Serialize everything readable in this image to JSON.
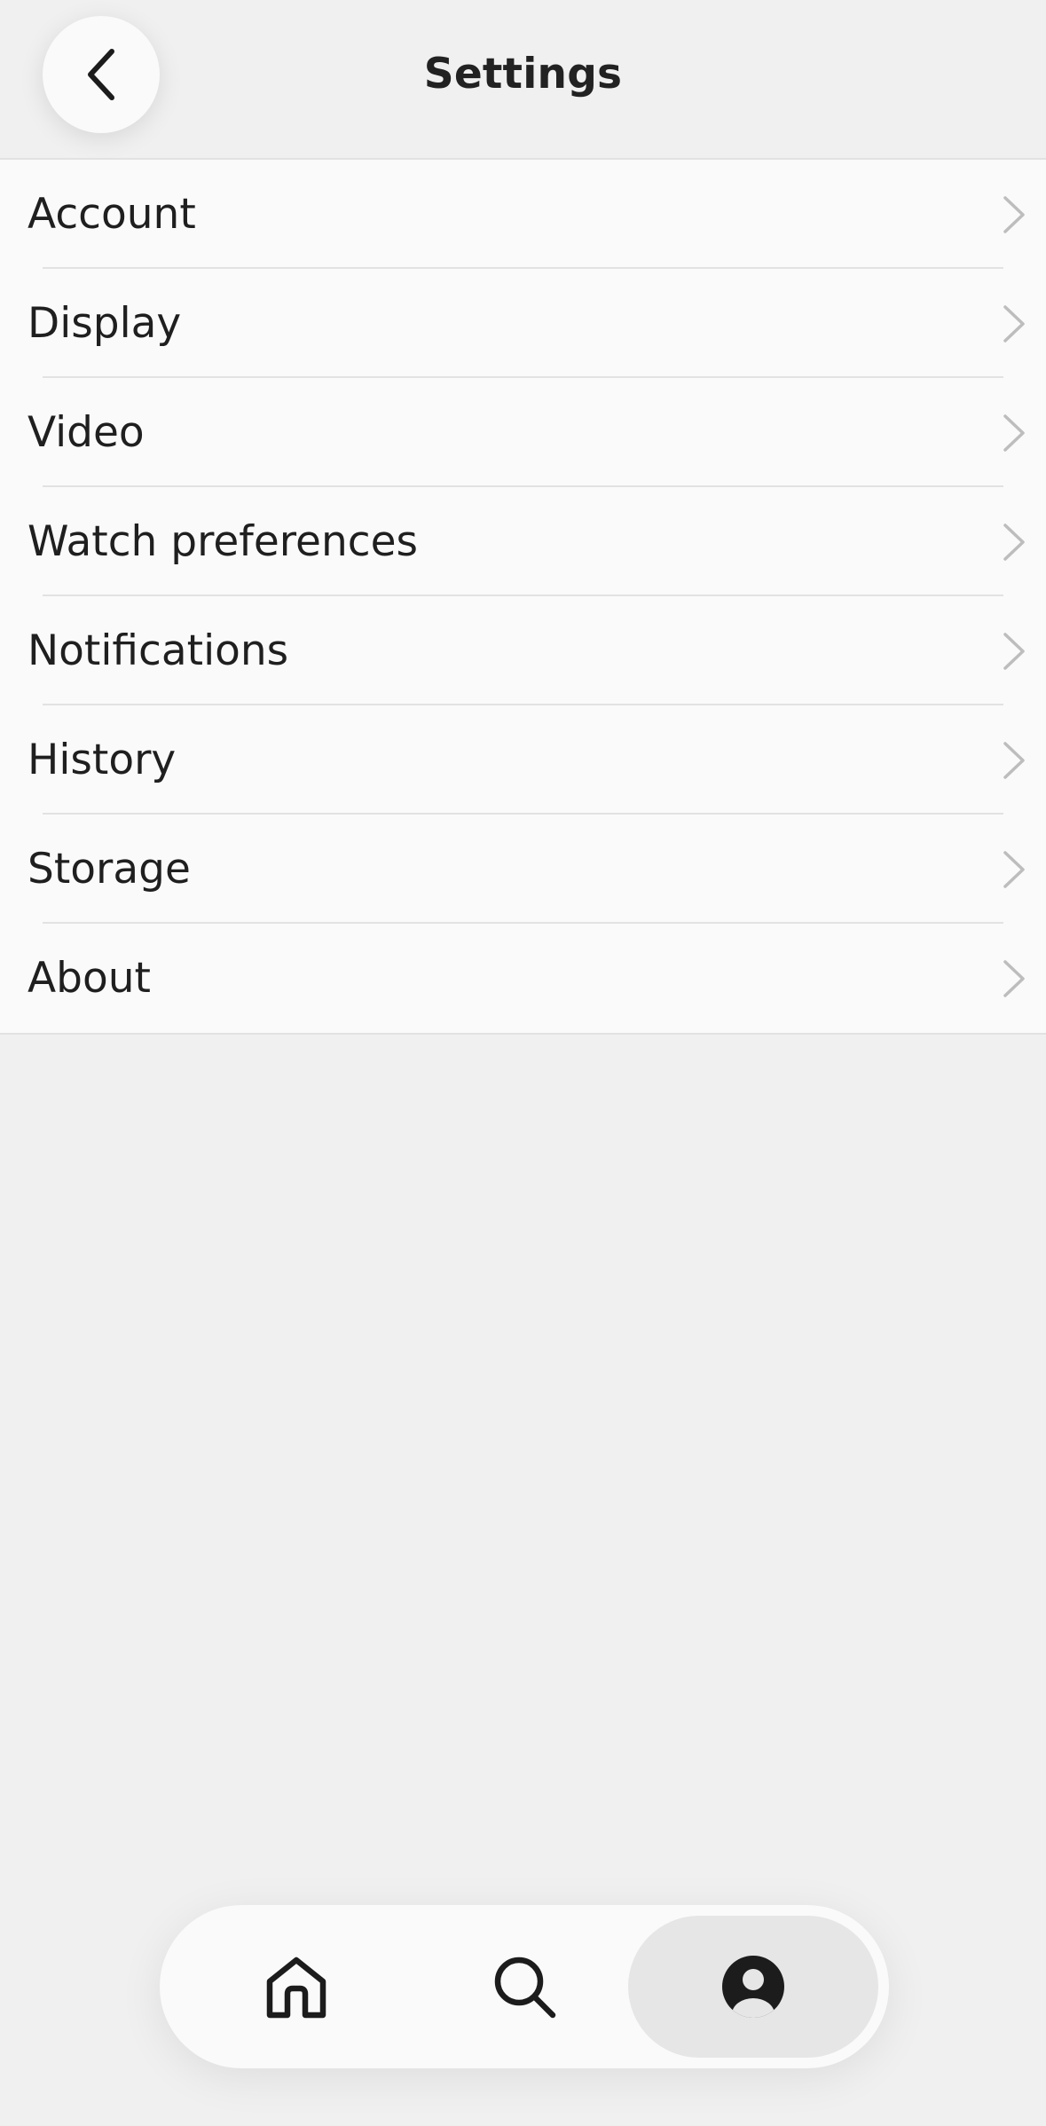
{
  "header": {
    "title": "Settings",
    "back_icon": "chevron-left-icon"
  },
  "settings": {
    "items": [
      {
        "label": "Account"
      },
      {
        "label": "Display"
      },
      {
        "label": "Video"
      },
      {
        "label": "Watch preferences"
      },
      {
        "label": "Notifications"
      },
      {
        "label": "History"
      },
      {
        "label": "Storage"
      },
      {
        "label": "About"
      }
    ],
    "chevron_icon": "chevron-right-icon"
  },
  "bottom_nav": {
    "tabs": [
      {
        "icon": "home-icon",
        "selected": false
      },
      {
        "icon": "search-icon",
        "selected": false
      },
      {
        "icon": "profile-icon",
        "selected": true
      }
    ]
  },
  "colors": {
    "background": "#f0f0f0",
    "surface": "#fafafa",
    "divider": "#e2e2e2",
    "text": "#1f1f1f",
    "chevron": "#bdbdbd",
    "selected_tab": "#e6e6e6"
  }
}
